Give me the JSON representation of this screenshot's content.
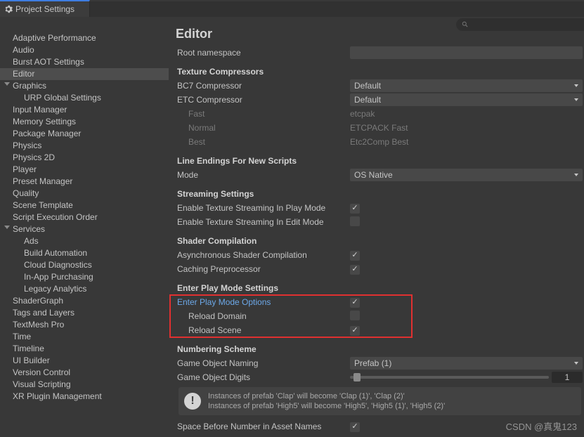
{
  "window": {
    "title": "Project Settings"
  },
  "sidebar": {
    "items": [
      {
        "label": "Adaptive Performance"
      },
      {
        "label": "Audio"
      },
      {
        "label": "Burst AOT Settings"
      },
      {
        "label": "Editor",
        "selected": true
      },
      {
        "label": "Graphics",
        "expandable": true
      },
      {
        "label": "URP Global Settings",
        "child": true
      },
      {
        "label": "Input Manager"
      },
      {
        "label": "Memory Settings"
      },
      {
        "label": "Package Manager"
      },
      {
        "label": "Physics"
      },
      {
        "label": "Physics 2D"
      },
      {
        "label": "Player"
      },
      {
        "label": "Preset Manager"
      },
      {
        "label": "Quality"
      },
      {
        "label": "Scene Template"
      },
      {
        "label": "Script Execution Order"
      },
      {
        "label": "Services",
        "expandable": true
      },
      {
        "label": "Ads",
        "child": true
      },
      {
        "label": "Build Automation",
        "child": true
      },
      {
        "label": "Cloud Diagnostics",
        "child": true
      },
      {
        "label": "In-App Purchasing",
        "child": true
      },
      {
        "label": "Legacy Analytics",
        "child": true
      },
      {
        "label": "ShaderGraph"
      },
      {
        "label": "Tags and Layers"
      },
      {
        "label": "TextMesh Pro"
      },
      {
        "label": "Time"
      },
      {
        "label": "Timeline"
      },
      {
        "label": "UI Builder"
      },
      {
        "label": "Version Control"
      },
      {
        "label": "Visual Scripting"
      },
      {
        "label": "XR Plugin Management"
      }
    ]
  },
  "editor": {
    "title": "Editor",
    "rootNamespaceLabel": "Root namespace",
    "textureCompressorsHead": "Texture Compressors",
    "bc7Label": "BC7 Compressor",
    "bc7Value": "Default",
    "etcLabel": "ETC Compressor",
    "etcValue": "Default",
    "fastLabel": "Fast",
    "fastValue": "etcpak",
    "normalLabel": "Normal",
    "normalValue": "ETCPACK Fast",
    "bestLabel": "Best",
    "bestValue": "Etc2Comp Best",
    "lineEndingsHead": "Line Endings For New Scripts",
    "modeLabel": "Mode",
    "modeValue": "OS Native",
    "streamingHead": "Streaming Settings",
    "enableTexPlayLabel": "Enable Texture Streaming In Play Mode",
    "enableTexEditLabel": "Enable Texture Streaming In Edit Mode",
    "shaderCompHead": "Shader Compilation",
    "asyncShaderLabel": "Asynchronous Shader Compilation",
    "cachingPreLabel": "Caching Preprocessor",
    "enterPlayHead": "Enter Play Mode Settings",
    "enterPlayOptLabel": "Enter Play Mode Options",
    "reloadDomainLabel": "Reload Domain",
    "reloadSceneLabel": "Reload Scene",
    "numberingHead": "Numbering Scheme",
    "gameObjNamingLabel": "Game Object Naming",
    "gameObjNamingValue": "Prefab (1)",
    "gameObjDigitsLabel": "Game Object Digits",
    "gameObjDigitsValue": "1",
    "infoLine1": "Instances of prefab 'Clap' will become 'Clap (1)', 'Clap (2)'",
    "infoLine2": "Instances of prefab 'High5' will become 'High5', 'High5 (1)', 'High5 (2)'",
    "spaceBeforeLabel": "Space Before Number in Asset Names"
  },
  "watermark": "CSDN @真鬼123"
}
